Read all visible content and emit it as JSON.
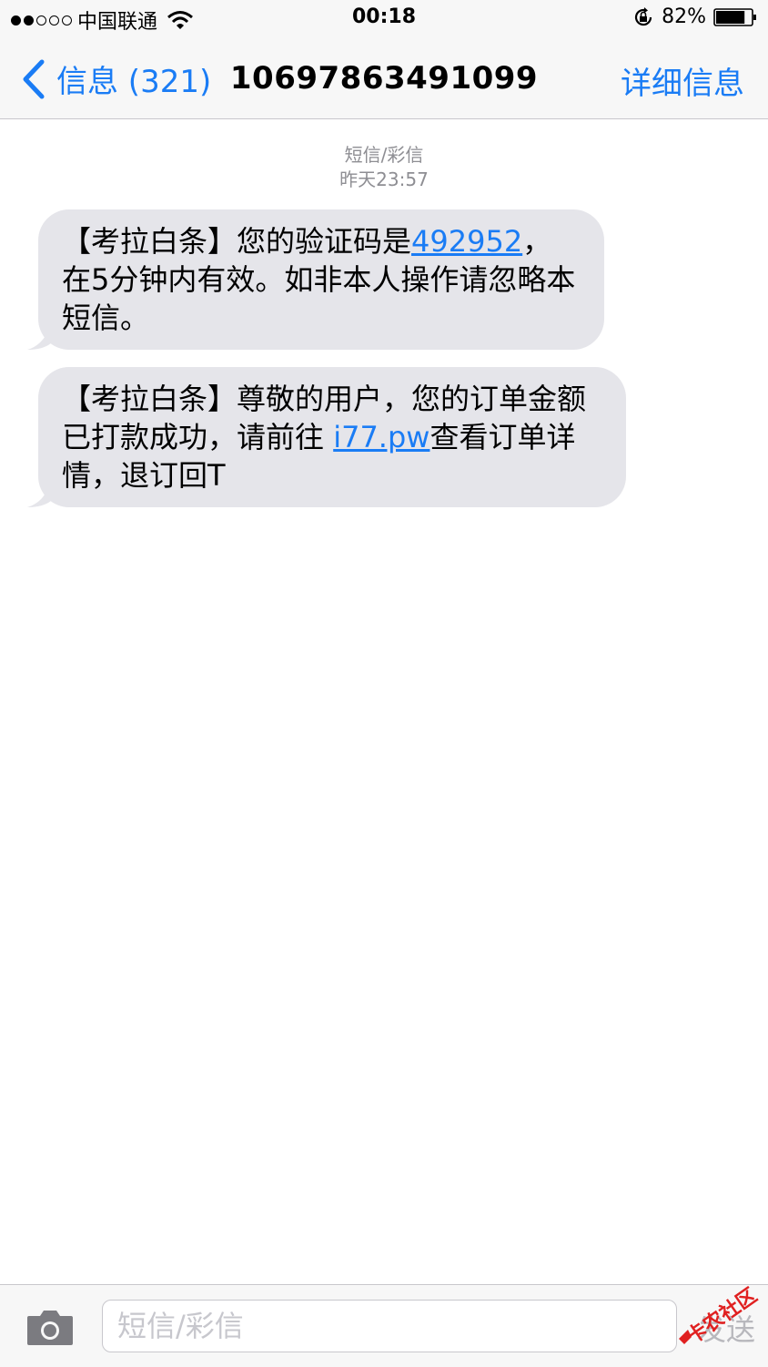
{
  "status_bar": {
    "signal_dots_filled": 2,
    "signal_dots_total": 5,
    "carrier": "中国联通",
    "time": "00:18",
    "battery_percent": "82%",
    "battery_level": 0.82
  },
  "nav": {
    "back_label": "信息 (321)",
    "title": "10697863491099",
    "details_label": "详细信息"
  },
  "thread": {
    "type_label": "短信/彩信",
    "timestamp": "昨天23:57"
  },
  "messages": [
    {
      "pre": "【考拉白条】您的验证码是",
      "link": "492952",
      "post": "，在5分钟内有效。如非本人操作请忽略本短信。"
    },
    {
      "pre": "【考拉白条】尊敬的用户，您的订单金额已打款成功，请前往 ",
      "link": "i77.pw",
      "post": "查看订单详情，退订回T"
    }
  ],
  "input_bar": {
    "placeholder": "短信/彩信",
    "send_label": "发送"
  },
  "watermark": {
    "text": "卡农社区"
  },
  "colors": {
    "accent": "#1a7cf5",
    "bubble": "#e5e5ea",
    "bar_background": "#f7f7f7"
  }
}
